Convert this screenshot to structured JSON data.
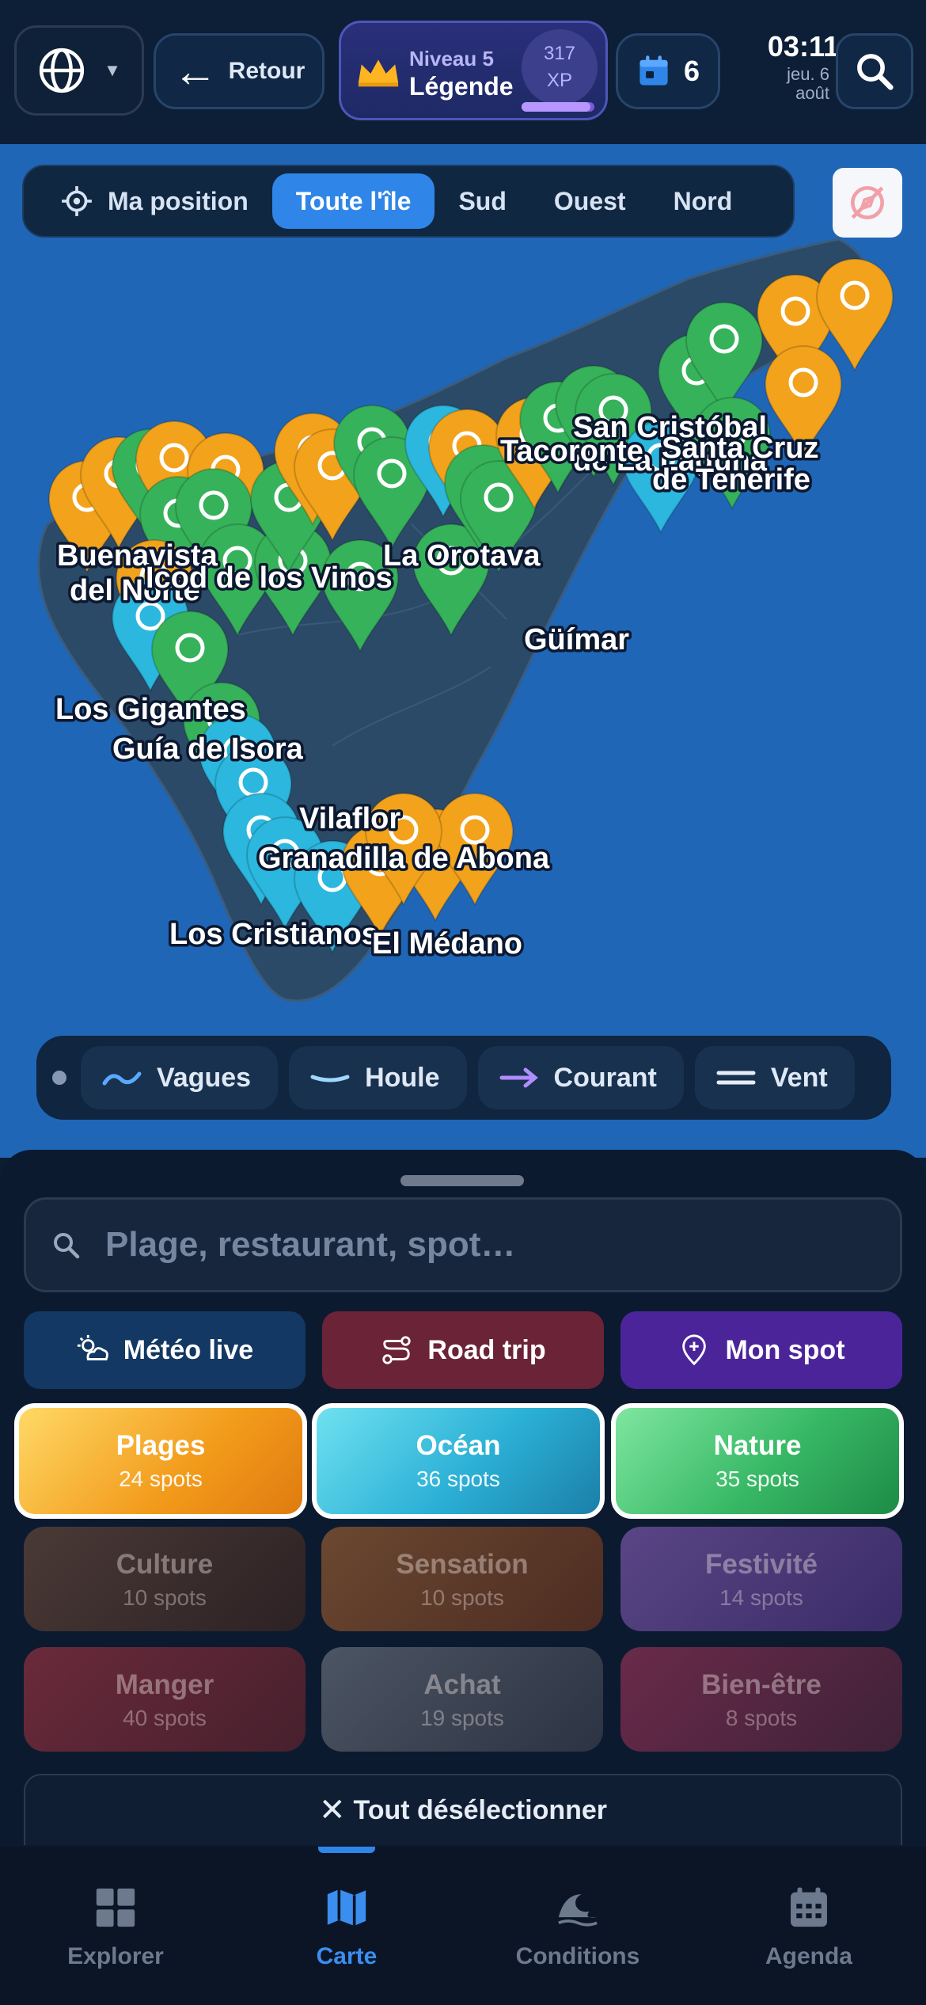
{
  "topbar": {
    "back_label": "Retour",
    "level_label": "Niveau 5",
    "level_rank": "Légende",
    "xp_value": "317",
    "xp_unit": "XP",
    "xp_progress": 0.95,
    "calendar_count": "6",
    "time": "03:11",
    "date_line1": "jeu. 6",
    "date_line2": "août"
  },
  "map": {
    "filters": [
      {
        "label": "Ma position",
        "active": false
      },
      {
        "label": "Toute l'île",
        "active": true
      },
      {
        "label": "Sud",
        "active": false
      },
      {
        "label": "Ouest",
        "active": false
      },
      {
        "label": "Nord",
        "active": false
      }
    ],
    "places": [
      "San Cristóbal de La Laguna",
      "Tacoronte",
      "Santa Cruz de Tenerife",
      "Buenavista del Norte",
      "Icod de los Vinos",
      "La Orotava",
      "Güímar",
      "Los Gigantes",
      "Guía de Isora",
      "Vilaflor",
      "Granadilla de Abona",
      "Los Cristianos",
      "El Médano"
    ],
    "place_labels": {
      "laguna_1": "San Cristóbal",
      "laguna_2": "de La Laguna",
      "tacoronte": "Tacoronte",
      "santacruz_1": "Santa Cruz",
      "santacruz_2": "de Tenerife",
      "buenavista_1": "Buenavista",
      "buenavista_2": "del Norte",
      "icod": "Icod de los Vinos",
      "orotava": "La Orotava",
      "guimar": "Güímar",
      "gigantes": "Los Gigantes",
      "guia": "Guía de Isora",
      "vilaflor": "Vilaflor",
      "granadilla": "Granadilla de Abona",
      "cristianos": "Los Cristianos",
      "medano": "El Médano"
    },
    "legend": [
      {
        "label": "Vagues",
        "color": "#5aa9ff"
      },
      {
        "label": "Houle",
        "color": "#9fd7ff"
      },
      {
        "label": "Courant",
        "color": "#b18cff"
      },
      {
        "label": "Vent",
        "color": "#e6ecf5"
      }
    ],
    "colors": {
      "water": "#1f66b7",
      "land": "#2b4b6b",
      "beach": "#f2a21b",
      "ocean": "#2bb7de",
      "nature": "#36b25a"
    }
  },
  "sheet": {
    "search_placeholder": "Plage, restaurant, spot…",
    "actions": [
      {
        "label": "Météo live",
        "icon": "weather-icon"
      },
      {
        "label": "Road trip",
        "icon": "route-icon"
      },
      {
        "label": "Mon spot",
        "icon": "pin-plus-icon"
      }
    ],
    "categories": [
      {
        "name": "Plages",
        "count": "24 spots",
        "selected": true
      },
      {
        "name": "Océan",
        "count": "36 spots",
        "selected": true
      },
      {
        "name": "Nature",
        "count": "35 spots",
        "selected": true
      },
      {
        "name": "Culture",
        "count": "10 spots",
        "selected": false
      },
      {
        "name": "Sensation",
        "count": "10 spots",
        "selected": false
      },
      {
        "name": "Festivité",
        "count": "14 spots",
        "selected": false
      },
      {
        "name": "Manger",
        "count": "40 spots",
        "selected": false
      },
      {
        "name": "Achat",
        "count": "19 spots",
        "selected": false
      },
      {
        "name": "Bien-être",
        "count": "8 spots",
        "selected": false
      }
    ],
    "deselect_label": "Tout désélectionner"
  },
  "nav": [
    {
      "label": "Explorer",
      "active": false
    },
    {
      "label": "Carte",
      "active": true
    },
    {
      "label": "Conditions",
      "active": false
    },
    {
      "label": "Agenda",
      "active": false
    }
  ]
}
